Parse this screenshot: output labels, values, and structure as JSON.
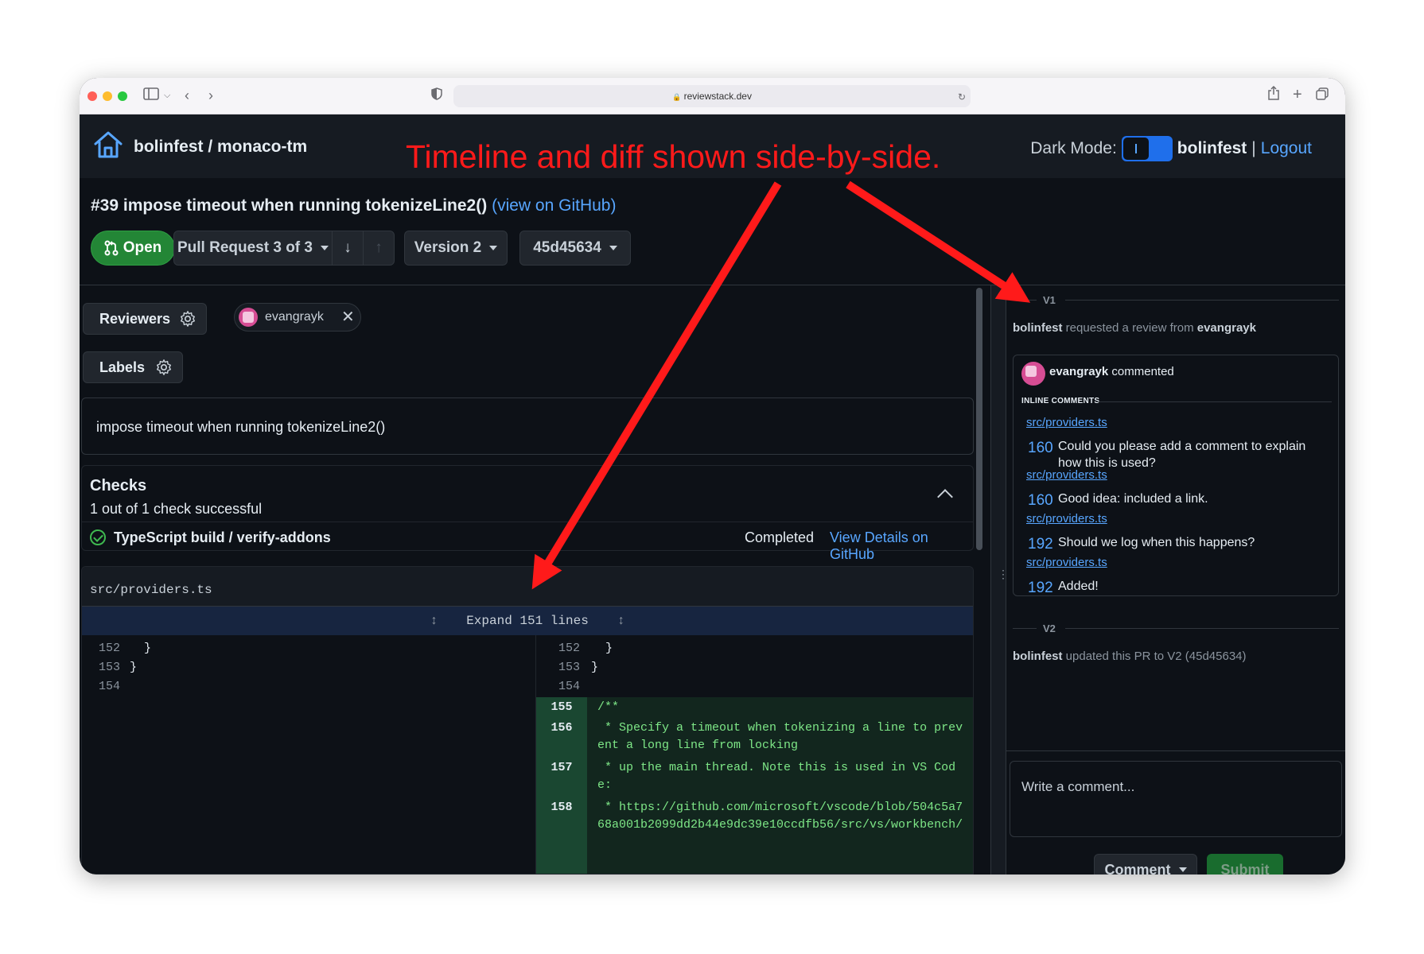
{
  "browser": {
    "url": "reviewstack.dev"
  },
  "header": {
    "repo": "bolinfest / monaco-tm",
    "dark_mode_label": "Dark Mode:",
    "username": "bolinfest",
    "separator": "|",
    "logout": "Logout"
  },
  "annotation": {
    "text": "Timeline and diff shown side-by-side."
  },
  "pr": {
    "title": "#39 impose timeout when running tokenizeLine2()",
    "github_link": "(view on GitHub)",
    "status": "Open",
    "pull_request_selector": "Pull Request 3 of 3",
    "version_selector": "Version 2",
    "commit_selector": "45d45634"
  },
  "sidebar": {
    "reviewers_label": "Reviewers",
    "reviewer_name": "evangrayk",
    "labels_label": "Labels",
    "description": "impose timeout when running tokenizeLine2()"
  },
  "checks": {
    "title": "Checks",
    "summary": "1 out of 1 check successful",
    "items": [
      {
        "name": "TypeScript build / verify-addons",
        "status": "Completed",
        "link": "View Details on GitHub"
      }
    ]
  },
  "diff": {
    "file": "src/providers.ts",
    "expand_label": "Expand 151 lines",
    "left_lines": [
      {
        "num": "152",
        "text": "  }"
      },
      {
        "num": "153",
        "text": "}"
      },
      {
        "num": "154",
        "text": ""
      }
    ],
    "right_context": [
      {
        "num": "152",
        "text": "  }"
      },
      {
        "num": "153",
        "text": "}"
      },
      {
        "num": "154",
        "text": ""
      }
    ],
    "right_added": [
      {
        "num": "155",
        "lines": [
          "/**"
        ]
      },
      {
        "num": "156",
        "lines": [
          " * Specify a timeout when tokenizing a line to prev",
          "ent a long line from locking"
        ]
      },
      {
        "num": "157",
        "lines": [
          " * up the main thread. Note this is used in VS Cod",
          "e:"
        ]
      },
      {
        "num": "158",
        "lines": [
          " * https://github.com/microsoft/vscode/blob/504c5a7",
          "68a001b2099dd2b44e9dc39e10ccdfb56/src/vs/workbench/"
        ]
      }
    ]
  },
  "timeline": {
    "v1_label": "V1",
    "v1_event_actor": "bolinfest",
    "v1_event_text": "requested a review from",
    "v1_event_target": "evangrayk",
    "comment_author": "evangrayk",
    "comment_verb": "commented",
    "inline_comments_header": "INLINE COMMENTS",
    "inline_comments": [
      {
        "file": "src/providers.ts",
        "line": "160",
        "text": "Could you please add a comment to explain how this is used?"
      },
      {
        "file": "src/providers.ts",
        "line": "160",
        "text": "Good idea: included a link."
      },
      {
        "file": "src/providers.ts",
        "line": "192",
        "text": "Should we log when this happens?"
      },
      {
        "file": "src/providers.ts",
        "line": "192",
        "text": "Added!"
      }
    ],
    "v2_label": "V2",
    "v2_event_actor": "bolinfest",
    "v2_event_text": "updated this PR to V2 (45d45634)",
    "write_placeholder": "Write a comment...",
    "comment_button": "Comment",
    "submit_button": "Submit"
  },
  "colors": {
    "accent_blue": "#58a6ff",
    "open_green": "#238636",
    "annotation_red": "#ff1a1a"
  }
}
